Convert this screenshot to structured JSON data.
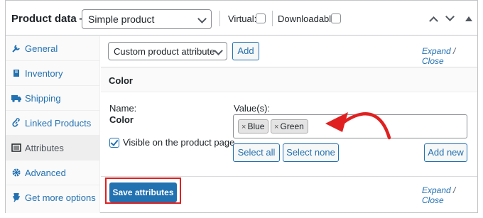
{
  "header": {
    "title": "Product data —",
    "product_type": "Simple product",
    "virtual_label": "Virtual:",
    "downloadable_label": "Downloadable:"
  },
  "sidebar": {
    "items": [
      {
        "label": "General",
        "icon": "wrench-icon"
      },
      {
        "label": "Inventory",
        "icon": "diamond-icon"
      },
      {
        "label": "Shipping",
        "icon": "truck-icon"
      },
      {
        "label": "Linked Products",
        "icon": "link-icon"
      },
      {
        "label": "Attributes",
        "icon": "list-icon",
        "active": true
      },
      {
        "label": "Advanced",
        "icon": "gear-icon"
      },
      {
        "label": "Get more options",
        "icon": "plugin-icon"
      }
    ]
  },
  "attributes": {
    "select_value": "Custom product attribute",
    "add_label": "Add",
    "expand_label": "Expand",
    "separator": "/",
    "close_label": "Close",
    "attribute_name": "Color",
    "name_label": "Name:",
    "name_value": "Color",
    "values_label": "Value(s):",
    "tokens": [
      "Blue",
      "Green"
    ],
    "token_remove": "×",
    "visible_label": "Visible on the product page",
    "visible_checked": true,
    "select_all_label": "Select all",
    "select_none_label": "Select none",
    "add_new_label": "Add new",
    "save_label": "Save attributes"
  },
  "colors": {
    "accent": "#2271b1",
    "annotation": "#e02020"
  }
}
